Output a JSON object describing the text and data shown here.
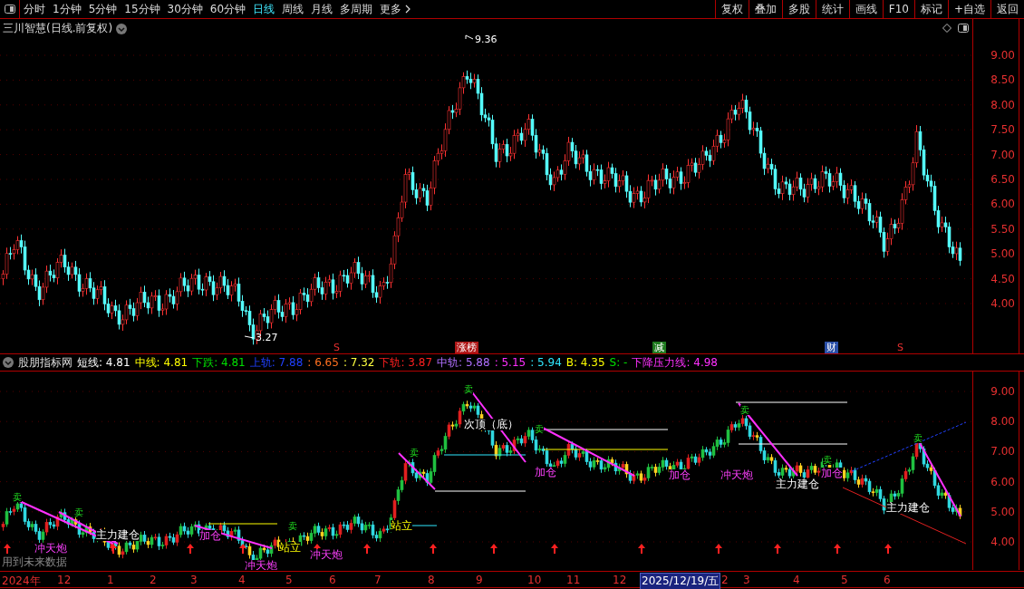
{
  "toolbar": {
    "tabs": [
      {
        "label": "分时",
        "selected": false
      },
      {
        "label": "1分钟",
        "selected": false
      },
      {
        "label": "5分钟",
        "selected": false
      },
      {
        "label": "15分钟",
        "selected": false
      },
      {
        "label": "30分钟",
        "selected": false
      },
      {
        "label": "60分钟",
        "selected": false
      },
      {
        "label": "日线",
        "selected": true
      },
      {
        "label": "周线",
        "selected": false
      },
      {
        "label": "月线",
        "selected": false
      },
      {
        "label": "多周期",
        "selected": false
      }
    ],
    "more": "更多",
    "buttons": [
      "复权",
      "叠加",
      "多股",
      "统计",
      "画线",
      "F10",
      "标记",
      "+自选",
      "返回"
    ]
  },
  "main_chart": {
    "title": "三川智慧(日线.前复权)",
    "high_label": "9.36",
    "low_label": "3.27",
    "events": [
      {
        "text": "S",
        "kind": "letter",
        "color": "#e83030"
      },
      {
        "text": "涨榜",
        "kind": "tag",
        "color": "#b01818"
      },
      {
        "text": "减",
        "kind": "tag",
        "color": "#1f7a1f"
      },
      {
        "text": "财",
        "kind": "tag",
        "color": "#2a4fa8"
      },
      {
        "text": "S",
        "kind": "letter",
        "color": "#e83030"
      }
    ],
    "y_ticks": [
      "9.00",
      "8.50",
      "8.00",
      "7.50",
      "7.00",
      "6.50",
      "6.00",
      "5.50",
      "5.00",
      "4.50",
      "4.00"
    ]
  },
  "indicator": {
    "name": "股朋指标网",
    "legend": [
      {
        "text": "短线: 4.81",
        "color": "#ffffff"
      },
      {
        "text": "中线: 4.81",
        "color": "#ffff00"
      },
      {
        "text": "下跌: 4.81",
        "color": "#00e000"
      },
      {
        "text": "上轨: 7.88",
        "color": "#2040ff"
      },
      {
        "text": ": 6.65",
        "color": "#ff7020"
      },
      {
        "text": ": 7.32",
        "color": "#ffff40"
      },
      {
        "text": "下轨: 3.87",
        "color": "#ff2020"
      },
      {
        "text": "中轨: 5.88",
        "color": "#b070ff"
      },
      {
        "text": ": 5.15",
        "color": "#ff30ff"
      },
      {
        "text": ": 5.94",
        "color": "#30e8ff"
      },
      {
        "text": "B: 4.35",
        "color": "#ffff00"
      },
      {
        "text": "S: -",
        "color": "#00e000"
      },
      {
        "text": "下降压力线: 4.98",
        "color": "#ff30ff"
      }
    ],
    "signals": [
      {
        "text": "冲天炮",
        "kind": "rocket"
      },
      {
        "text": "主力建仓",
        "kind": "build"
      },
      {
        "text": "加仓",
        "kind": "add"
      },
      {
        "text": "冲天炮",
        "kind": "rocket"
      },
      {
        "text": "站立",
        "kind": "stand"
      },
      {
        "text": "冲天炮",
        "kind": "rocket"
      },
      {
        "text": "站立",
        "kind": "stand"
      },
      {
        "text": "次顶（底）",
        "kind": "build"
      },
      {
        "text": "加仓",
        "kind": "add"
      },
      {
        "text": "加仓",
        "kind": "add"
      },
      {
        "text": "冲天炮",
        "kind": "rocket"
      },
      {
        "text": "主力建仓",
        "kind": "build"
      },
      {
        "text": "加仓",
        "kind": "add"
      },
      {
        "text": "主力建仓",
        "kind": "build"
      },
      {
        "text": "卖",
        "kind": "sell"
      },
      {
        "text": "卖",
        "kind": "sell"
      },
      {
        "text": "卖",
        "kind": "sell"
      },
      {
        "text": "卖",
        "kind": "sell"
      },
      {
        "text": "卖",
        "kind": "sell"
      },
      {
        "text": "卖",
        "kind": "sell"
      },
      {
        "text": "卖",
        "kind": "sell"
      },
      {
        "text": "卖",
        "kind": "sell"
      },
      {
        "text": "卖",
        "kind": "sell"
      }
    ],
    "note": "用到未来数据",
    "y_ticks": [
      "9.00",
      "8.00",
      "7.00",
      "6.00",
      "5.00",
      "4.00"
    ]
  },
  "x_axis": {
    "labels": [
      "2024年",
      "12",
      "1",
      "2",
      "3",
      "4",
      "5",
      "6",
      "7",
      "8",
      "9",
      "10",
      "11",
      "12",
      "2",
      "3",
      "4",
      "5",
      "6"
    ],
    "cursor_date": "2025/12/19/五"
  }
}
